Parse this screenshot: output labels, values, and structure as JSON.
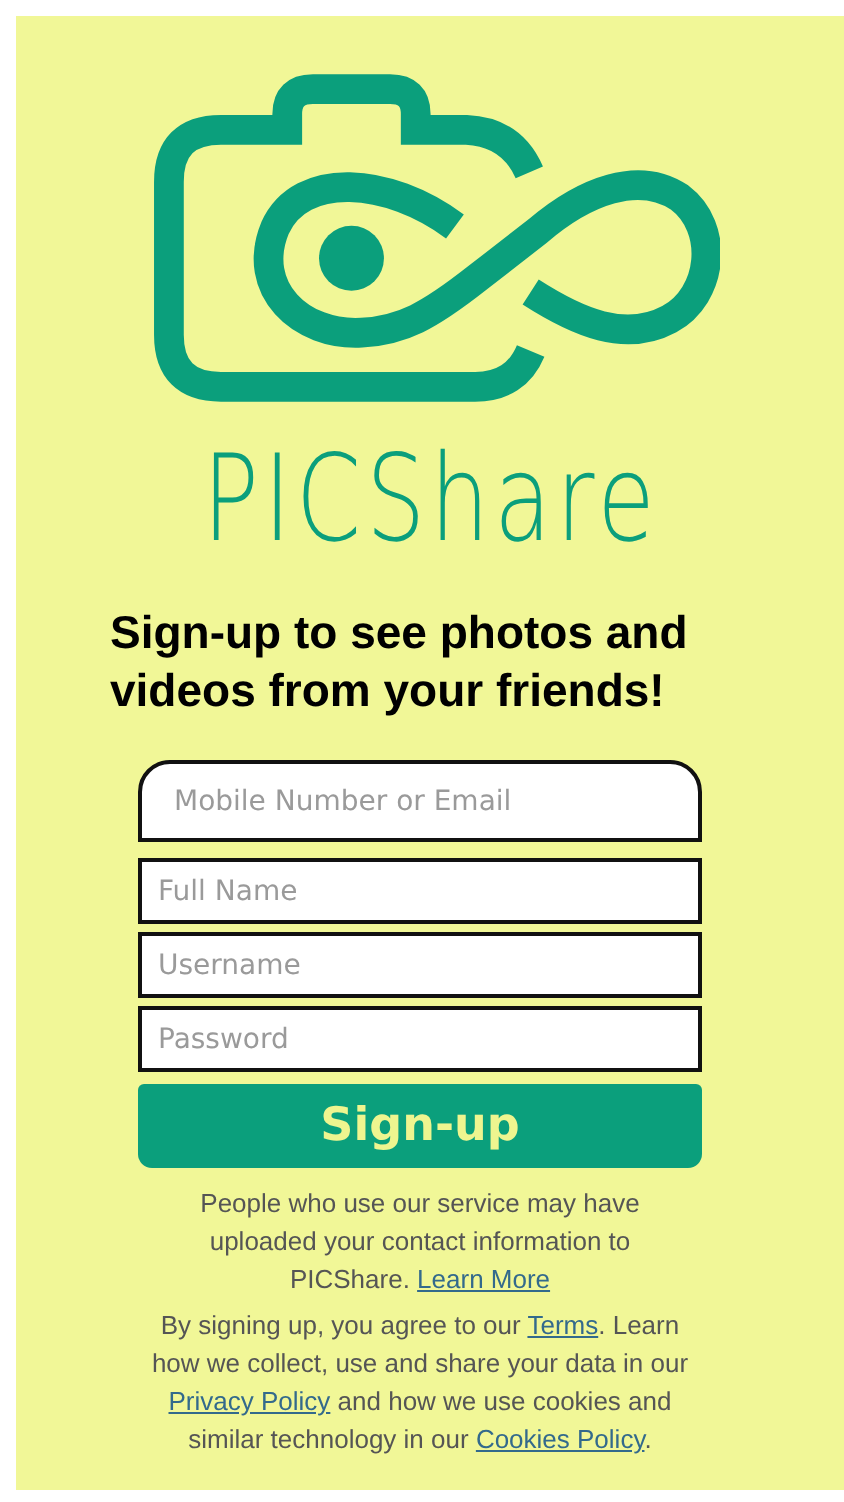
{
  "brand": {
    "name": "PICShare"
  },
  "headline": "Sign-up to see photos and videos from your friends!",
  "fields": [
    {
      "placeholder": "Mobile Number or Email",
      "kind": "rounded"
    },
    {
      "placeholder": "Full Name",
      "kind": "plain"
    },
    {
      "placeholder": "Username",
      "kind": "plain"
    },
    {
      "placeholder": "Password",
      "kind": "password"
    }
  ],
  "submit": "Sign-up",
  "notices": [
    {
      "parts": [
        {
          "kind": "text",
          "text": "People who use our service may have uploaded your contact information to PICShare. "
        },
        {
          "kind": "link",
          "text": "Learn More"
        }
      ]
    },
    {
      "parts": [
        {
          "kind": "text",
          "text": "By signing up, you agree to our "
        },
        {
          "kind": "link",
          "text": "Terms"
        },
        {
          "kind": "text",
          "text": ". Learn how we collect, use and share your data in our "
        },
        {
          "kind": "link",
          "text": "Privacy Policy"
        },
        {
          "kind": "text",
          "text": " and how we use cookies and similar technology in our "
        },
        {
          "kind": "link",
          "text": "Cookies Policy"
        },
        {
          "kind": "text",
          "text": "."
        }
      ]
    }
  ]
}
